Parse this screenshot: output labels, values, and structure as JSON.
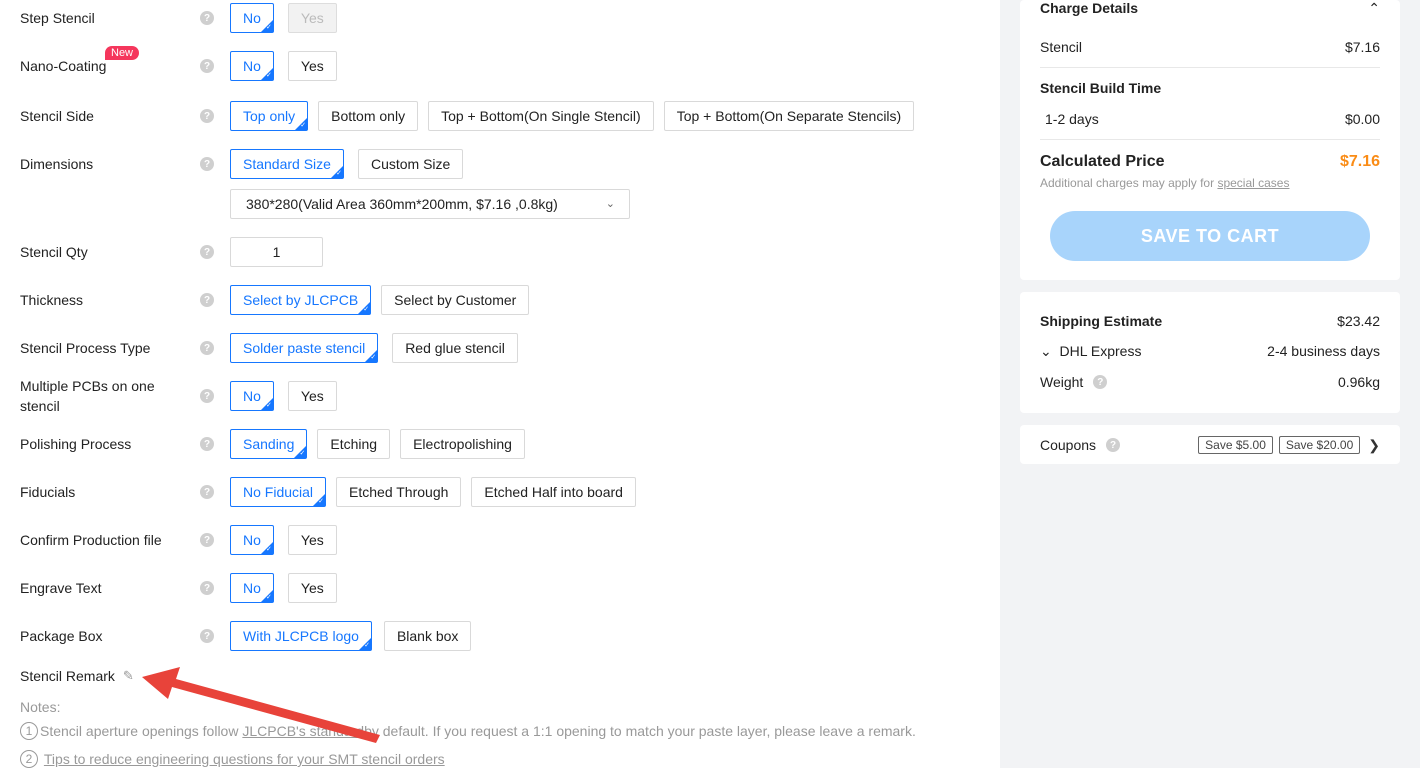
{
  "form": {
    "step_stencil": {
      "label": "Step Stencil",
      "opts": [
        "No",
        "Yes"
      ]
    },
    "nano_coating": {
      "label": "Nano-Coating",
      "badge": "New",
      "opts": [
        "No",
        "Yes"
      ]
    },
    "stencil_side": {
      "label": "Stencil Side",
      "opts": [
        "Top only",
        "Bottom only",
        "Top + Bottom(On Single Stencil)",
        "Top + Bottom(On Separate Stencils)"
      ]
    },
    "dimensions": {
      "label": "Dimensions",
      "opts": [
        "Standard Size",
        "Custom Size"
      ],
      "select_value": "380*280(Valid Area 360mm*200mm, $7.16 ,0.8kg)"
    },
    "stencil_qty": {
      "label": "Stencil Qty",
      "value": "1"
    },
    "thickness": {
      "label": "Thickness",
      "opts": [
        "Select by JLCPCB",
        "Select by Customer"
      ]
    },
    "process_type": {
      "label": "Stencil Process Type",
      "opts": [
        "Solder paste stencil",
        "Red glue stencil"
      ]
    },
    "multiple_pcbs": {
      "label1": "Multiple PCBs on one",
      "label2": "stencil",
      "opts": [
        "No",
        "Yes"
      ]
    },
    "polishing": {
      "label": "Polishing Process",
      "opts": [
        "Sanding",
        "Etching",
        "Electropolishing"
      ]
    },
    "fiducials": {
      "label": "Fiducials",
      "opts": [
        "No Fiducial",
        "Etched Through",
        "Etched Half into board"
      ]
    },
    "confirm_file": {
      "label": "Confirm Production file",
      "opts": [
        "No",
        "Yes"
      ]
    },
    "engrave_text": {
      "label": "Engrave Text",
      "opts": [
        "No",
        "Yes"
      ]
    },
    "package_box": {
      "label": "Package Box",
      "opts": [
        "With JLCPCB logo",
        "Blank box"
      ]
    },
    "remark_label": "Stencil Remark",
    "notes_title": "Notes:",
    "note1_num": "1",
    "note1_a": "Stencil aperture openings follow ",
    "note1_link": "JLCPCB's standard",
    "note1_b": " by default. If you request a 1:1 opening to match your paste layer, please leave a remark.",
    "note2_num": "2",
    "note2_link": "Tips to reduce engineering questions for your SMT stencil orders"
  },
  "charges": {
    "title": "Charge Details",
    "stencil_label": "Stencil",
    "stencil_value": "$7.16",
    "build_title": "Stencil Build Time",
    "build_label": "1-2 days",
    "build_value": "$0.00",
    "calc_label": "Calculated Price",
    "calc_value": "$7.16",
    "additional": "Additional charges may apply for ",
    "special_cases": "special cases",
    "save_button": "SAVE TO CART"
  },
  "shipping": {
    "title": "Shipping Estimate",
    "value": "$23.42",
    "method": "DHL Express",
    "method_time": "2-4 business days",
    "weight_label": "Weight",
    "weight_value": "0.96kg"
  },
  "coupons": {
    "label": "Coupons",
    "tags": [
      "Save $5.00",
      "Save $20.00"
    ]
  },
  "colors": {
    "accent": "#1677ff",
    "price": "#fa8c16",
    "badge": "#f5365c",
    "button": "#a8d4fb"
  }
}
